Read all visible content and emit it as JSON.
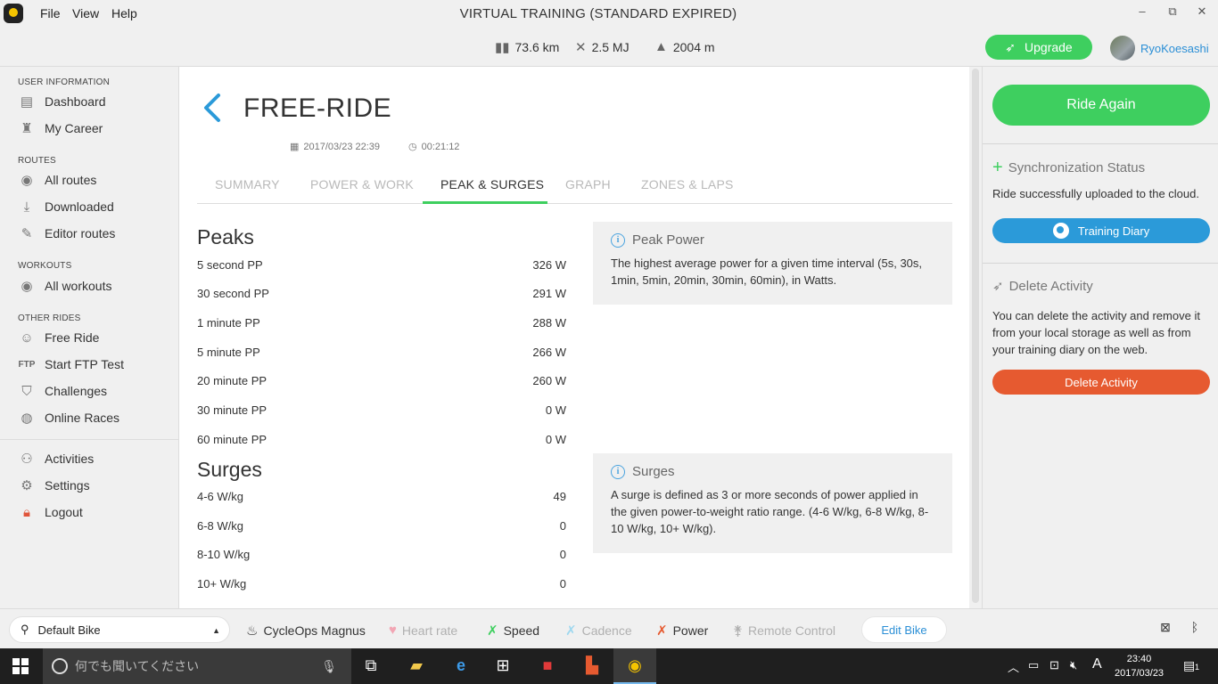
{
  "window": {
    "title": "VIRTUAL TRAINING (STANDARD EXPIRED)",
    "menus": [
      "File",
      "View",
      "Help"
    ],
    "controls": [
      "–",
      "⧉",
      "✕"
    ]
  },
  "stats": {
    "distance": "73.6 km",
    "energy": "2.5 MJ",
    "elevation": "2004 m"
  },
  "header": {
    "upgrade_label": "Upgrade",
    "username": "RyoKoesashi"
  },
  "sidebar": {
    "sections": {
      "user": "USER INFORMATION",
      "routes": "ROUTES",
      "workouts": "WORKOUTS",
      "other": "OTHER RIDES"
    },
    "items": {
      "dashboard": "Dashboard",
      "my_career": "My Career",
      "all_routes": "All routes",
      "downloaded": "Downloaded",
      "editor_routes": "Editor routes",
      "all_workouts": "All workouts",
      "free_ride": "Free Ride",
      "ftp_badge": "FTP",
      "start_ftp": "Start FTP Test",
      "challenges": "Challenges",
      "online_races": "Online Races",
      "activities": "Activities",
      "settings": "Settings",
      "logout": "Logout"
    }
  },
  "activity": {
    "title": "FREE-RIDE",
    "date": "2017/03/23 22:39",
    "duration": "00:21:12",
    "tabs": [
      "SUMMARY",
      "POWER & WORK",
      "PEAK & SURGES",
      "GRAPH",
      "ZONES & LAPS"
    ],
    "active_tab": "PEAK & SURGES"
  },
  "peaks": {
    "title": "Peaks",
    "rows": [
      {
        "label": "5 second PP",
        "value": "326 W"
      },
      {
        "label": "30 second PP",
        "value": "291 W"
      },
      {
        "label": "1 minute PP",
        "value": "288 W"
      },
      {
        "label": "5 minute PP",
        "value": "266 W"
      },
      {
        "label": "20 minute PP",
        "value": "260 W"
      },
      {
        "label": "30 minute PP",
        "value": "0 W"
      },
      {
        "label": "60 minute PP",
        "value": "0 W"
      }
    ]
  },
  "surges": {
    "title": "Surges",
    "rows": [
      {
        "label": "4-6 W/kg",
        "value": "49"
      },
      {
        "label": "6-8 W/kg",
        "value": "0"
      },
      {
        "label": "8-10 W/kg",
        "value": "0"
      },
      {
        "label": "10+ W/kg",
        "value": "0"
      }
    ]
  },
  "info_peak": {
    "title": "Peak Power",
    "body": "The highest average power for a given time interval (5s, 30s, 1min, 5min, 20min, 30min, 60min), in Watts."
  },
  "info_surges": {
    "title": "Surges",
    "body": "A surge is defined as 3 or more seconds of power applied in the given power-to-weight ratio range. (4-6 W/kg, 6-8 W/kg, 8-10 W/kg, 10+ W/kg)."
  },
  "right": {
    "ride_again": "Ride Again",
    "sync_title": "Synchronization Status",
    "sync_text": "Ride successfully uploaded to the cloud.",
    "training_diary": "Training Diary",
    "delete_title": "Delete Activity",
    "delete_text": "You can delete the activity and remove it from your local storage as well as from your training diary on the web.",
    "delete_button": "Delete Activity"
  },
  "devices": {
    "bike": "Default Bike",
    "trainer": "CycleOps Magnus",
    "heart_rate": "Heart rate",
    "speed": "Speed",
    "cadence": "Cadence",
    "power": "Power",
    "remote": "Remote Control",
    "edit_bike": "Edit Bike"
  },
  "taskbar": {
    "search_placeholder": "何でも聞いてください",
    "ime": "A",
    "time": "23:40",
    "date": "2017/03/23",
    "notifications": "1"
  },
  "colors": {
    "accent_green": "#3ecf5f",
    "accent_blue": "#2b9ad9",
    "danger": "#e65a30"
  }
}
